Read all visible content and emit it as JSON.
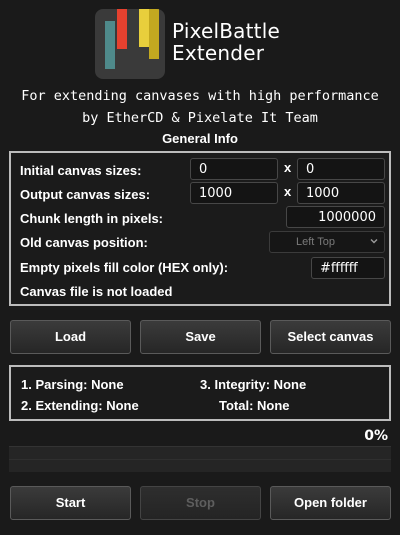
{
  "app": {
    "title_line1": "PixelBattle",
    "title_line2": "Extender",
    "subtitle_line1": "For extending canvases with high performance",
    "subtitle_line2": "by EtherCD & Pixelate It Team",
    "logo_colors": [
      "#4f8a8b",
      "#e5412f",
      "#e8cf3c",
      "#c2a820"
    ]
  },
  "general_info": {
    "title": "General Info",
    "initial_size_label": "Initial canvas sizes:",
    "initial_width": "0",
    "initial_height": "0",
    "output_size_label": "Output canvas sizes:",
    "output_width": "1000",
    "output_height": "1000",
    "size_separator": "x",
    "chunk_label": "Chunk length in pixels:",
    "chunk_value": "1000000",
    "position_label": "Old canvas position:",
    "position_value": "Left Top",
    "fill_label": "Empty pixels fill color (HEX only):",
    "fill_value": "#ffffff",
    "file_status": "Canvas file is not loaded"
  },
  "actions": {
    "load": "Load",
    "save": "Save",
    "select_canvas": "Select canvas"
  },
  "stages": {
    "parsing": "1. Parsing: None",
    "extending": "2. Extending: None",
    "integrity": "3. Integrity: None",
    "total": "Total: None"
  },
  "progress": {
    "percent_label": "0%",
    "fraction": 0
  },
  "controls": {
    "start": "Start",
    "stop": "Stop",
    "open_folder": "Open folder"
  }
}
